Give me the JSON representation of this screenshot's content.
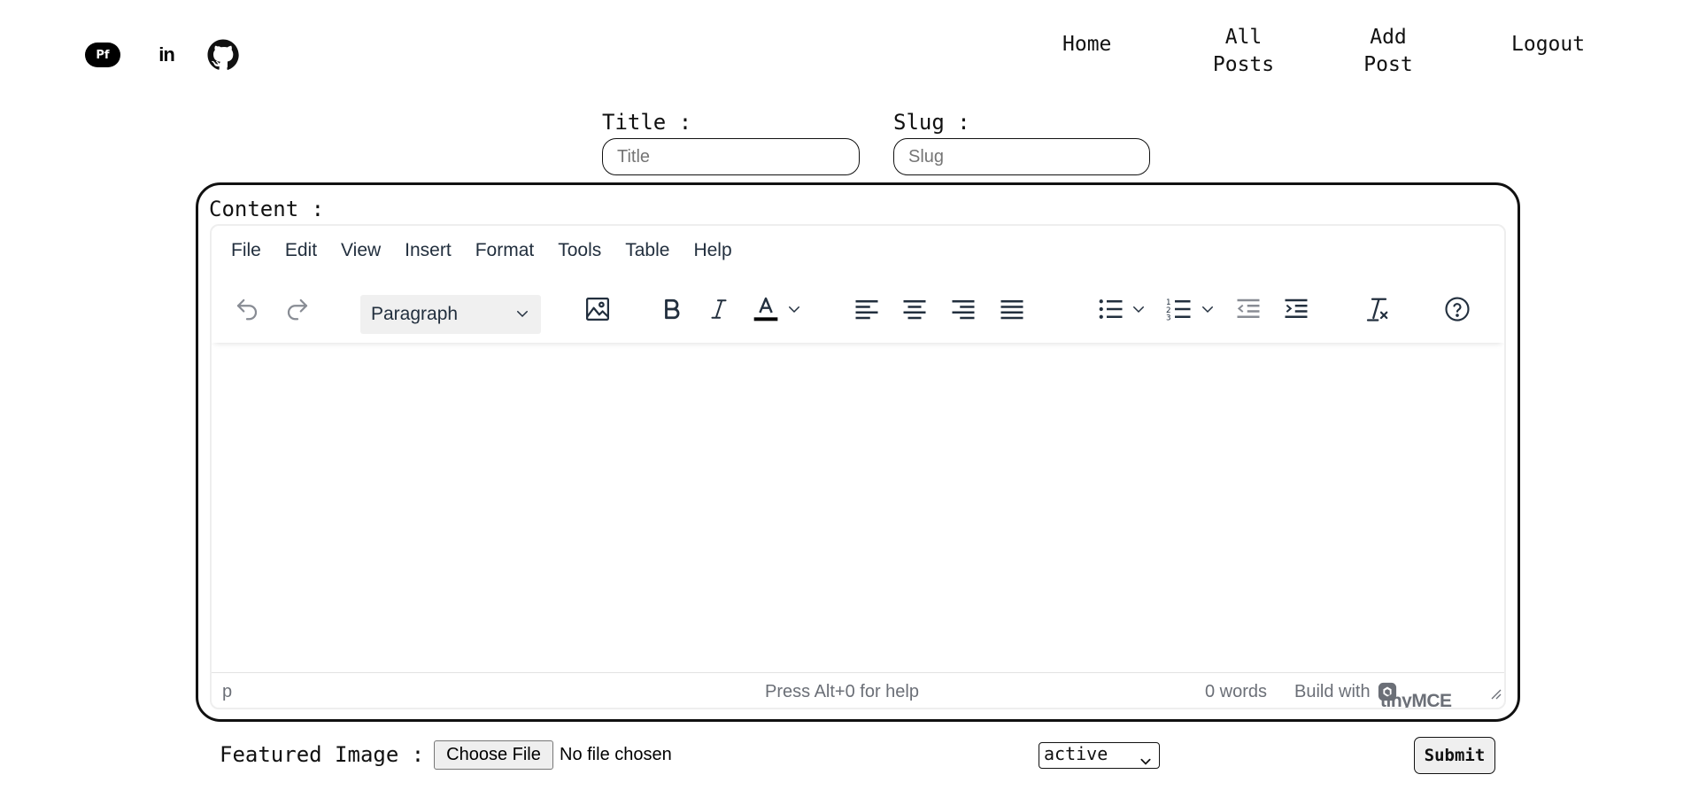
{
  "header": {
    "social": [
      {
        "name": "portfolio",
        "label": "Pf",
        "icon": "portfolio-icon"
      },
      {
        "name": "linkedin",
        "label": "in",
        "icon": "linkedin-icon"
      },
      {
        "name": "github",
        "icon": "github-icon"
      }
    ],
    "nav": {
      "home": "Home",
      "all_posts": "All\nPosts",
      "add_post": "Add\nPost",
      "logout": "Logout"
    }
  },
  "form": {
    "title_label": "Title :",
    "title_placeholder": "Title",
    "title_value": "",
    "slug_label": "Slug :",
    "slug_placeholder": "Slug",
    "slug_value": "",
    "content_label": "Content :",
    "featured_image_label": "Featured Image :",
    "choose_file_label": "Choose File",
    "file_status": "No file chosen",
    "status_value": "active",
    "submit_label": "Submit"
  },
  "editor": {
    "menu": [
      "File",
      "Edit",
      "View",
      "Insert",
      "Format",
      "Tools",
      "Table",
      "Help"
    ],
    "block_format": "Paragraph",
    "toolbar_icons": [
      "undo-icon",
      "redo-icon",
      "image-icon",
      "bold-icon",
      "italic-icon",
      "text-color-icon",
      "align-left-icon",
      "align-center-icon",
      "align-right-icon",
      "align-justify-icon",
      "bullet-list-icon",
      "numbered-list-icon",
      "outdent-icon",
      "indent-icon",
      "clear-formatting-icon",
      "help-icon"
    ],
    "status": {
      "path": "p",
      "help": "Press Alt+0 for help",
      "word_count": "0 words",
      "build_with": "Build with",
      "brand": "tinyMCE"
    }
  },
  "colors": {
    "ink": "#111111",
    "toolbar_icon": "#222f3e",
    "disabled_icon": "#888c94",
    "text_color_bar": "#000000",
    "status_text": "#6b6f77"
  }
}
